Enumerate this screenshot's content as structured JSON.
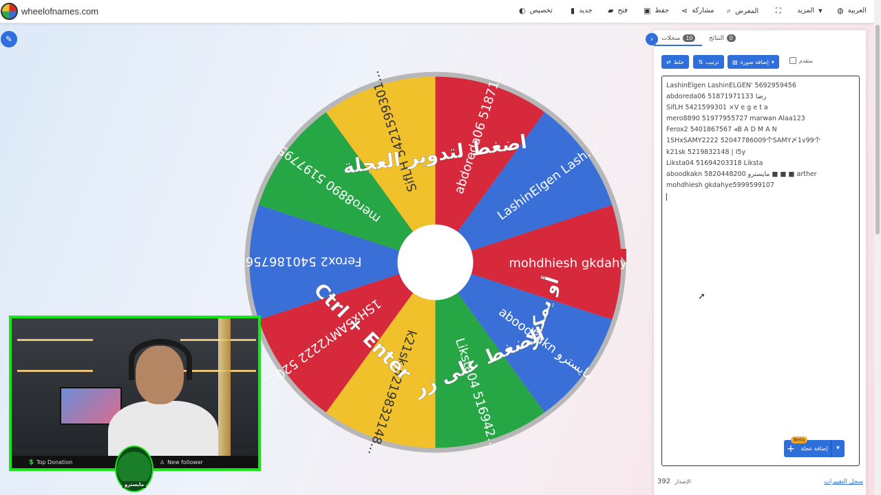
{
  "site": {
    "name": "wheelofnames.com"
  },
  "topbar": {
    "items": [
      {
        "label": "تخصيص",
        "icon": "palette-icon",
        "glyph": "🎨"
      },
      {
        "label": "جديد",
        "icon": "new-file-icon",
        "glyph": "▮"
      },
      {
        "label": "فتح",
        "icon": "folder-icon",
        "glyph": "▰"
      },
      {
        "label": "حفظ",
        "icon": "save-icon",
        "glyph": "▣"
      },
      {
        "label": "مشاركة",
        "icon": "share-icon",
        "glyph": "⋖"
      },
      {
        "label": "المعرض",
        "icon": "search-icon",
        "glyph": "⌕"
      },
      {
        "label": "",
        "icon": "fullscreen-icon",
        "glyph": "⛶"
      },
      {
        "label": "المزيد",
        "icon": "caret-down-icon",
        "glyph": "▾"
      },
      {
        "label": "العربية",
        "icon": "globe-icon",
        "glyph": "◍"
      }
    ]
  },
  "wheel": {
    "center_text_line1": "اضغط لتدوير العجلة",
    "center_text_line2": "أو يمكنك",
    "center_text_line3": "الضغط على زر",
    "center_text_line4": "Ctrl + Enter",
    "segments": [
      {
        "label": "mohdhiesh  gkdahy...",
        "color": "#d6293c"
      },
      {
        "label": "aboodkakn  مايسترو",
        "color": "#3a6fd8"
      },
      {
        "label": "Liksta04  516942...",
        "color": "#26a645"
      },
      {
        "label": "k21sk  5219832148...",
        "color": "#f1c12b"
      },
      {
        "label": "1SHxSAMY2222  520...",
        "color": "#d6293c"
      },
      {
        "label": "Ferox2  540186756...",
        "color": "#3a6fd8"
      },
      {
        "label": "mero8890  5197795...",
        "color": "#26a645"
      },
      {
        "label": "SifLH  5421599301...",
        "color": "#f1c12b"
      },
      {
        "label": "abdoreda06  51871...",
        "color": "#d6293c"
      },
      {
        "label": "LashinElgen  Lash...",
        "color": "#3a6fd8"
      }
    ]
  },
  "panel": {
    "tab_entries": "منخلات",
    "tab_entries_count": "10",
    "tab_results": "النتائج",
    "tab_results_count": "0",
    "shuffle_label": "خلط",
    "sort_label": "ترتيب",
    "add_image_label": "إضافة صورة",
    "advanced_label": "متقدم",
    "entries": [
      "LashinElgen  LashinELGEN' 5692959456",
      "abdoreda06  51871971133 رضا",
      "SifLH   5421599301 ×V e g e t a",
      "mero8890  51977955727 marwan Alaa123",
      "Ferox2  5401867567 ⫷B A D M A N",
      "1SHxSAMY2222  52047786009个SAMY〆1v99个",
      "k21sk  5219832148 | I5y",
      "Liksta04   51694203318 Liksta",
      "aboodkakn  5820448200 مايسترو ■ ■ ■ arther",
      "mohdhiesh  gkdahye5999599107"
    ],
    "add_wheel_label": "إضافة عجلة",
    "beta_label": "Beta",
    "version_label": "الإصدار",
    "version_number": "392",
    "changelog_label": "سجل التغييرات"
  },
  "webcam": {
    "top_donation": "Top Donation",
    "new_follower": "New follower",
    "badge_text": "مايسترو"
  },
  "colors": {
    "accent": "#2f6fdb",
    "red": "#d6293c",
    "blue": "#3a6fd8",
    "green": "#26a645",
    "yellow": "#f1c12b",
    "webcam_border": "#15e615"
  }
}
